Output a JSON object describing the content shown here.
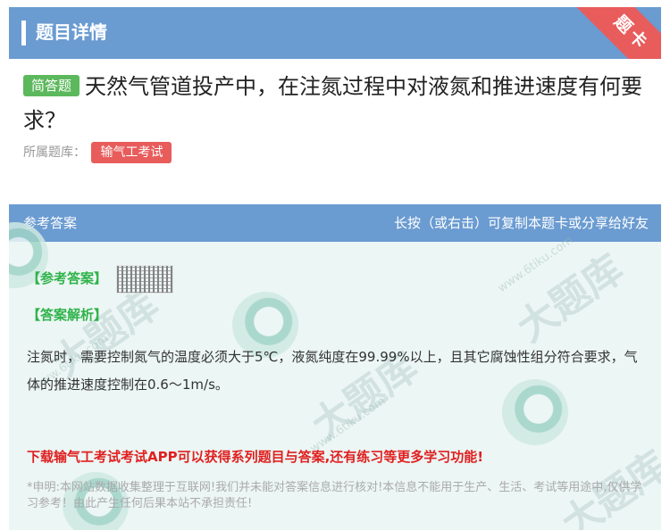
{
  "header": {
    "title": "题目详情",
    "corner_ribbon": "题卡"
  },
  "question": {
    "type_badge": "简答题",
    "text": "天然气管道投产中，在注氮过程中对液氮和推进速度有何要求？"
  },
  "source": {
    "label": "所属题库：",
    "tag": "输气工考试"
  },
  "answer_card": {
    "header_left": "参考答案",
    "header_right": "长按（或右击）可复制本题卡或分享给好友",
    "ref_answer_label": "【参考答案】",
    "analysis_label": "【答案解析】",
    "analysis_text": "注氮时，需要控制氮气的温度必须大于5℃，液氮纯度在99.99%以上，且其它腐蚀性组分符合要求，气体的推进速度控制在0.6～1m/s。",
    "promo": "下载输气工考试考试APP可以获得系列题目与答案,还有练习等更多学习功能!",
    "disclaimer": "*申明:本网站数据收集整理于互联网!我们并未能对答案信息进行核对!本信息不能用于生产、生活、考试等用途中,仅供学习参考！由此产生任何后果本站不承担责任!"
  },
  "watermark": {
    "brand": "大题库",
    "domain": "www.6tiku.com"
  },
  "colors": {
    "header_blue": "#6a9bd1",
    "badge_green": "#5cb85c",
    "tag_red": "#e85c5c",
    "label_green": "#2fb34a",
    "promo_red": "#e02020",
    "card_bg": "#ecf6f4"
  }
}
